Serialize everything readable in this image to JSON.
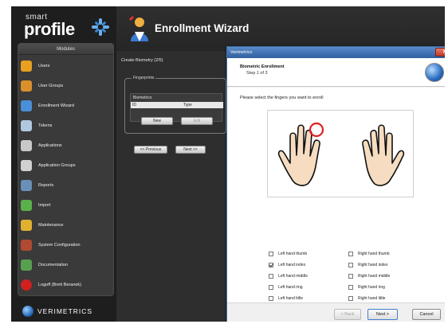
{
  "app": {
    "logo": {
      "top": "smart",
      "main": "profile"
    },
    "modules_title": "Modules",
    "modules": [
      {
        "label": "Users",
        "icon": "user-icon",
        "color": "#e8a020"
      },
      {
        "label": "User Groups",
        "icon": "user-group-icon",
        "color": "#d9902a"
      },
      {
        "label": "Enrollment Wizard",
        "icon": "enrollment-wizard-icon",
        "color": "#4a8fd8"
      },
      {
        "label": "Tokens",
        "icon": "token-icon",
        "color": "#b0c8e0"
      },
      {
        "label": "Applications",
        "icon": "application-icon",
        "color": "#c8c8c8"
      },
      {
        "label": "Application Groups",
        "icon": "application-group-icon",
        "color": "#d0d0d0"
      },
      {
        "label": "Reports",
        "icon": "report-icon",
        "color": "#6a8fb8"
      },
      {
        "label": "Import",
        "icon": "import-icon",
        "color": "#5ab04a"
      },
      {
        "label": "Maintenance",
        "icon": "maintenance-icon",
        "color": "#e0b030"
      },
      {
        "label": "System Configuration",
        "icon": "system-config-icon",
        "color": "#b04a30"
      },
      {
        "label": "Documentation",
        "icon": "documentation-icon",
        "color": "#58a050"
      },
      {
        "label": "Logoff (Brett Beranek)",
        "icon": "logoff-icon",
        "color": "#d02020"
      }
    ],
    "brand": "VERIMETRICS"
  },
  "wizard": {
    "title": "Enrollment Wizard",
    "step_bar": "Create Biometry (2/5)",
    "fingerprints_legend": "Fingerprints",
    "biometrics_title": "Biometrics",
    "columns": [
      "ID",
      "Type"
    ],
    "buttons": {
      "new": "New",
      "edit": "Edit",
      "previous": "<< Previous",
      "next": "Next >>"
    }
  },
  "dialog": {
    "window_title": "Verimetrics",
    "heading": "Biometric Enrollment",
    "step": "Step 1 of 3",
    "instruction": "Please select the fingers you want to enroll",
    "fingers": [
      {
        "label": "Left hand thumb",
        "checked": false
      },
      {
        "label": "Left hand index",
        "checked": true
      },
      {
        "label": "Left hand middle",
        "checked": false
      },
      {
        "label": "Left hand ring",
        "checked": false
      },
      {
        "label": "Left hand little",
        "checked": false
      },
      {
        "label": "Right hand thumb",
        "checked": false
      },
      {
        "label": "Right hand index",
        "checked": false
      },
      {
        "label": "Right hand middle",
        "checked": false
      },
      {
        "label": "Right hand ring",
        "checked": false
      },
      {
        "label": "Right hand little",
        "checked": false
      }
    ],
    "buttons": {
      "back": "< Back",
      "next": "Next >",
      "cancel": "Cancel"
    }
  },
  "colors": {
    "accent": "#2f5f9e",
    "highlight": "#e02020",
    "skin": "#f6dcc0"
  }
}
